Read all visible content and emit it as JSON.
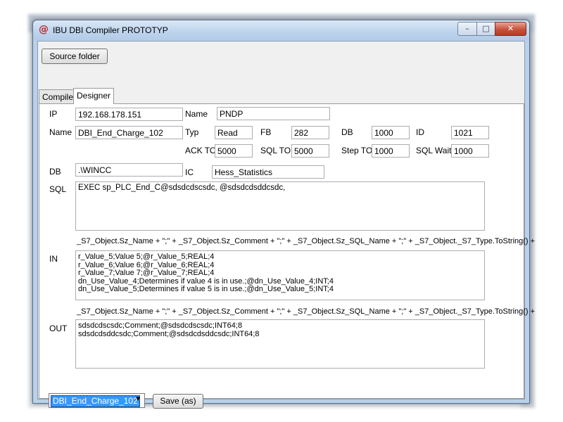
{
  "window": {
    "title": "IBU DBI Compiler PROTOTYP",
    "app_icon": "@",
    "controls": {
      "minimize": "–",
      "maximize": "□",
      "close": "✕"
    }
  },
  "toolbar": {
    "source_folder_label": "Source folder"
  },
  "tabs": [
    {
      "label": "Compiler"
    },
    {
      "label": "Designer"
    }
  ],
  "form": {
    "ip_label": "IP",
    "ip_value": "192.168.178.151",
    "name1_label": "Name",
    "name1_value": "PNDP",
    "name2_label": "Name",
    "name2_value": "DBI_End_Charge_102",
    "typ_label": "Typ",
    "typ_value": "Read",
    "fb_label": "FB",
    "fb_value": "282",
    "db1_label": "DB",
    "db1_value": "1000",
    "id_label": "ID",
    "id_value": "1021",
    "ack_label": "ACK TO",
    "ack_value": "5000",
    "sqlto_label": "SQL TO",
    "sqlto_value": "5000",
    "stepto_label": "Step TO",
    "stepto_value": "1000",
    "sqlwait_label": "SQL Wait",
    "sqlwait_value": "1000",
    "db2_label": "DB",
    "db2_value": ".\\WINCC",
    "ic_label": "IC",
    "ic_value": "Hess_Statistics",
    "sql_label": "SQL",
    "sql_value": "EXEC sp_PLC_End_C@sdsdcdscsdc, @sdsdcdsddcsdc,",
    "expr1": "_S7_Object.Sz_Name + \";\" + _S7_Object.Sz_Comment + \";\" + _S7_Object.Sz_SQL_Name + \";\" + _S7_Object._S7_Type.ToString() +",
    "in_label": "IN",
    "in_value": "r_Value_5;Value 5;@r_Value_5;REAL;4\nr_Value_6;Value 6;@r_Value_6;REAL;4\nr_Value_7;Value 7;@r_Value_7;REAL;4\ndn_Use_Value_4;Determines if value 4 is in use.;@dn_Use_Value_4;INT;4\ndn_Use_Value_5;Determines if value 5 is in use.;@dn_Use_Value_5;INT;4",
    "expr2": "_S7_Object.Sz_Name + \";\" + _S7_Object.Sz_Comment + \";\" + _S7_Object.Sz_SQL_Name + \";\" + _S7_Object._S7_Type.ToString() +",
    "out_label": "OUT",
    "out_value": "sdsdcdscsdc;Comment;@sdsdcdscsdc;INT64;8\nsdsdcdsddcsdc;Comment;@sdsdcdsddcsdc;INT64;8"
  },
  "footer": {
    "selector_value": "DBI_End_Charge_102",
    "save_label": "Save (as)"
  }
}
